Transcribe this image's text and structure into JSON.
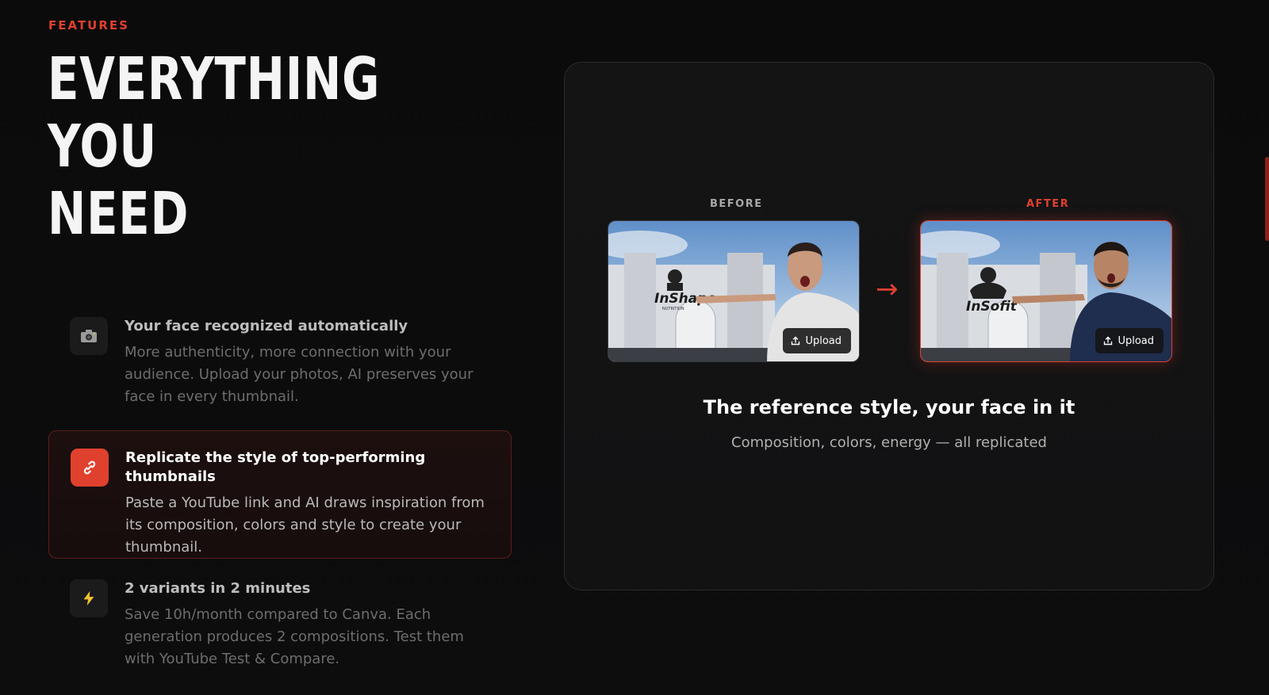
{
  "section": {
    "eyebrow": "FEATURES",
    "headline": [
      "EVERYTHING",
      "YOU",
      "NEED"
    ]
  },
  "features": [
    {
      "icon": "camera-icon",
      "title": "Your face recognized automatically",
      "description": "More authenticity, more connection with your audience. Upload your photos, AI preserves your face in every thumbnail.",
      "active": false
    },
    {
      "icon": "link-icon",
      "title": "Replicate the style of top-performing thumbnails",
      "description": "Paste a YouTube link and AI draws inspiration from its composition, colors and style to create your thumbnail.",
      "active": true
    },
    {
      "icon": "lightning-icon",
      "title": "2 variants in 2 minutes",
      "description": "Save 10h/month compared to Canva. Each generation produces 2 compositions. Test them with YouTube Test & Compare.",
      "active": false
    }
  ],
  "preview": {
    "before_label": "BEFORE",
    "after_label": "AFTER",
    "before_logo": "InShape",
    "before_logo_sub": "NUTRITION",
    "after_logo": "InSofit",
    "upload_label": "Upload",
    "caption_title": "The reference style, your face in it",
    "caption_sub": "Composition, colors, energy — all replicated"
  },
  "colors": {
    "accent": "#e0402e",
    "background": "#0b0b0c",
    "panel": "#141415"
  }
}
